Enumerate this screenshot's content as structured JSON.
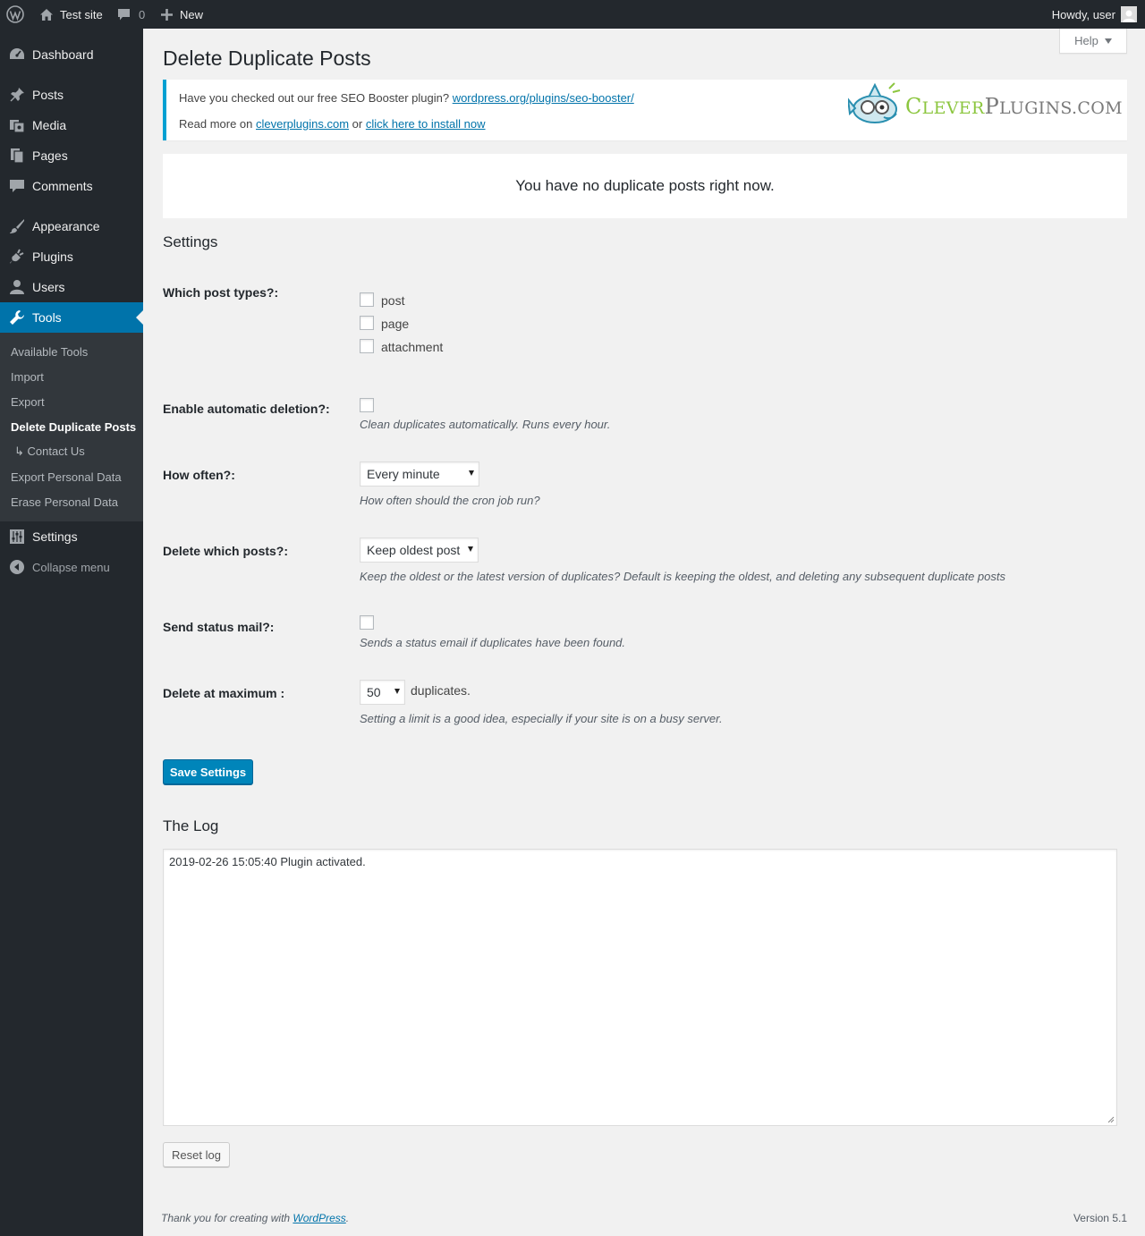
{
  "adminbar": {
    "site_name": "Test site",
    "comments_count": "0",
    "new_label": "New",
    "greeting": "Howdy, user"
  },
  "sidebar": {
    "items": [
      {
        "label": "Dashboard",
        "icon": "dashboard-icon"
      },
      {
        "label": "Posts",
        "icon": "pin-icon"
      },
      {
        "label": "Media",
        "icon": "media-icon"
      },
      {
        "label": "Pages",
        "icon": "pages-icon"
      },
      {
        "label": "Comments",
        "icon": "comment-icon"
      },
      {
        "label": "Appearance",
        "icon": "brush-icon"
      },
      {
        "label": "Plugins",
        "icon": "plug-icon"
      },
      {
        "label": "Users",
        "icon": "user-icon"
      },
      {
        "label": "Tools",
        "icon": "wrench-icon"
      },
      {
        "label": "Settings",
        "icon": "sliders-icon"
      },
      {
        "label": "Collapse menu",
        "icon": "collapse-icon"
      }
    ],
    "submenu": [
      "Available Tools",
      "Import",
      "Export",
      "Delete Duplicate Posts",
      "↳ Contact Us",
      "Export Personal Data",
      "Erase Personal Data"
    ]
  },
  "help_tab": "Help",
  "page_title": "Delete Duplicate Posts",
  "notice": {
    "line1_text": "Have you checked out our free SEO Booster plugin? ",
    "line1_link": "wordpress.org/plugins/seo-booster/",
    "line2_text": "Read more on ",
    "line2_link1": "cleverplugins.com",
    "line2_or": " or ",
    "line2_link2": "click here to install now",
    "logo_text": "CleverPlugins.com"
  },
  "no_dupes_message": "You have no duplicate posts right now.",
  "settings": {
    "heading": "Settings",
    "post_types_label": "Which post types?:",
    "post_types": [
      "post",
      "page",
      "attachment"
    ],
    "auto_delete_label": "Enable automatic deletion?:",
    "auto_delete_desc": "Clean duplicates automatically. Runs every hour.",
    "how_often_label": "How often?:",
    "how_often_value": "Every minute",
    "how_often_desc": "How often should the cron job run?",
    "which_posts_label": "Delete which posts?:",
    "which_posts_value": "Keep oldest post",
    "which_posts_desc": "Keep the oldest or the latest version of duplicates? Default is keeping the oldest, and deleting any subsequent duplicate posts",
    "status_mail_label": "Send status mail?:",
    "status_mail_desc": "Sends a status email if duplicates have been found.",
    "max_label": "Delete at maximum :",
    "max_value": "50",
    "max_suffix": "duplicates.",
    "max_desc": "Setting a limit is a good idea, especially if your site is on a busy server.",
    "save_button": "Save Settings"
  },
  "log": {
    "heading": "The Log",
    "content": "2019-02-26 15:05:40 Plugin activated.",
    "reset_button": "Reset log"
  },
  "footer": {
    "thanks_text": "Thank you for creating with ",
    "thanks_link": "WordPress",
    "thanks_end": ".",
    "version": "Version 5.1"
  },
  "colors": {
    "admin_dark": "#23282d",
    "accent_blue": "#0073aa",
    "notice_border": "#00a0d2",
    "logo_green": "#8cc63f",
    "logo_gray": "#7a7a7a"
  }
}
